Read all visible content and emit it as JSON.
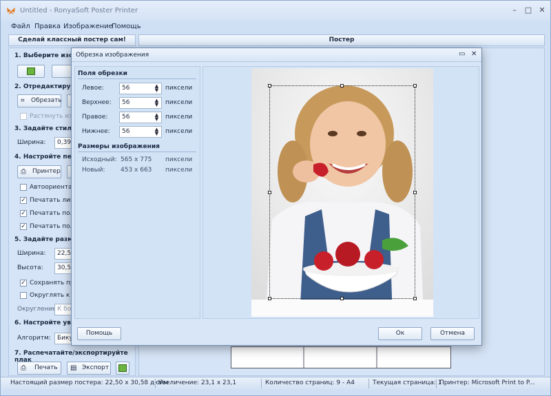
{
  "app": {
    "title": "Untitled - RonyaSoft Poster Printer"
  },
  "menu": [
    "Файл",
    "Правка",
    "Изображение",
    "Помощь"
  ],
  "headers": {
    "left": "Сделай классный постер сам!",
    "right": "Постер"
  },
  "left": {
    "s1": "1. Выберите изоб",
    "s2": "2. Отредактируй",
    "crop_btn": "Обрезать",
    "stretch": "Растянуть изо",
    "s3": "3. Задайте стиль р",
    "width_lbl": "Ширина:",
    "width_val": "0,39",
    "s4": "4. Настройте печа",
    "printer_btn": "Принтер",
    "auto": "Автоориентац",
    "print_lines": "Печатать лини",
    "print_fields": "Печатать поля",
    "print_fields2": "Печатать поля",
    "s5": "5. Задайте разме",
    "w2_lbl": "Ширина:",
    "w2_val": "22,5",
    "h2_lbl": "Высота:",
    "h2_val": "30,5",
    "keep": "Сохранять про",
    "round_to": "Округлять к р",
    "rounding_lbl": "Округление:",
    "rounding_val": "К бо",
    "s6": "6. Настройте увел",
    "algo_lbl": "Алгоритм:",
    "algo_val": "Бику",
    "s7": "7. Распечатайте/экспортируйте плак",
    "print_btn": "Печать",
    "export_btn": "Экспорт"
  },
  "status": {
    "size": "Настоящий размер постера: 22,50 x 30,58 дюйм",
    "zoom": "Увеличение: 23,1 x 23,1",
    "pages": "Количество страниц: 9 - A4",
    "current": "Текущая страница: 1",
    "printer": "Принтер: Microsoft Print to P..."
  },
  "dialog": {
    "title": "Обрезка изображения",
    "fields_group": "Поля обрезки",
    "left_lbl": "Левое:",
    "left_val": "56",
    "top_lbl": "Верхнее:",
    "top_val": "56",
    "right_lbl": "Правое:",
    "right_val": "56",
    "bottom_lbl": "Нижнее:",
    "bottom_val": "56",
    "unit": "пиксели",
    "size_group": "Размеры изображения",
    "orig_lbl": "Исходный:",
    "orig_val": "565 x 775",
    "new_lbl": "Новый:",
    "new_val": "453 x 663",
    "help_btn": "Помощь",
    "ok_btn": "Ок",
    "cancel_btn": "Отмена"
  },
  "colors": {
    "accent": "#cfe0f5",
    "dialog": "#d8e6f7"
  }
}
